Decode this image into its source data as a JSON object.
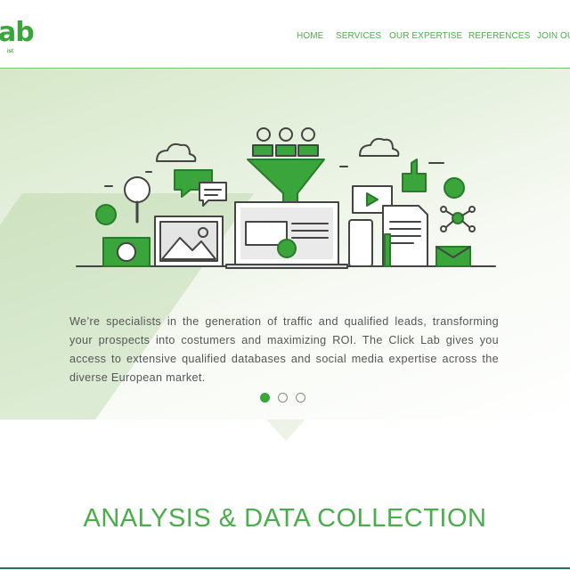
{
  "brand": {
    "logo_text": "ab",
    "tagline": "ist"
  },
  "nav": {
    "items": [
      "HOME",
      "SERVICES",
      "OUR EXPERTISE",
      "REFERENCES",
      "JOIN OU"
    ]
  },
  "hero": {
    "text": "We’re specialists in the generation of traffic and qualified leads, transforming your prospects into costumers and maximizing ROI. The Click Lab gives you access to extensive qualified databases and social media expertise across the diverse European market.",
    "slides": {
      "count": 3,
      "active": 1
    }
  },
  "section": {
    "title": "ANALYSIS & DATA COLLECTION"
  },
  "colors": {
    "accent": "#3aa53a",
    "text": "#555555",
    "icon_stroke": "#444444"
  }
}
